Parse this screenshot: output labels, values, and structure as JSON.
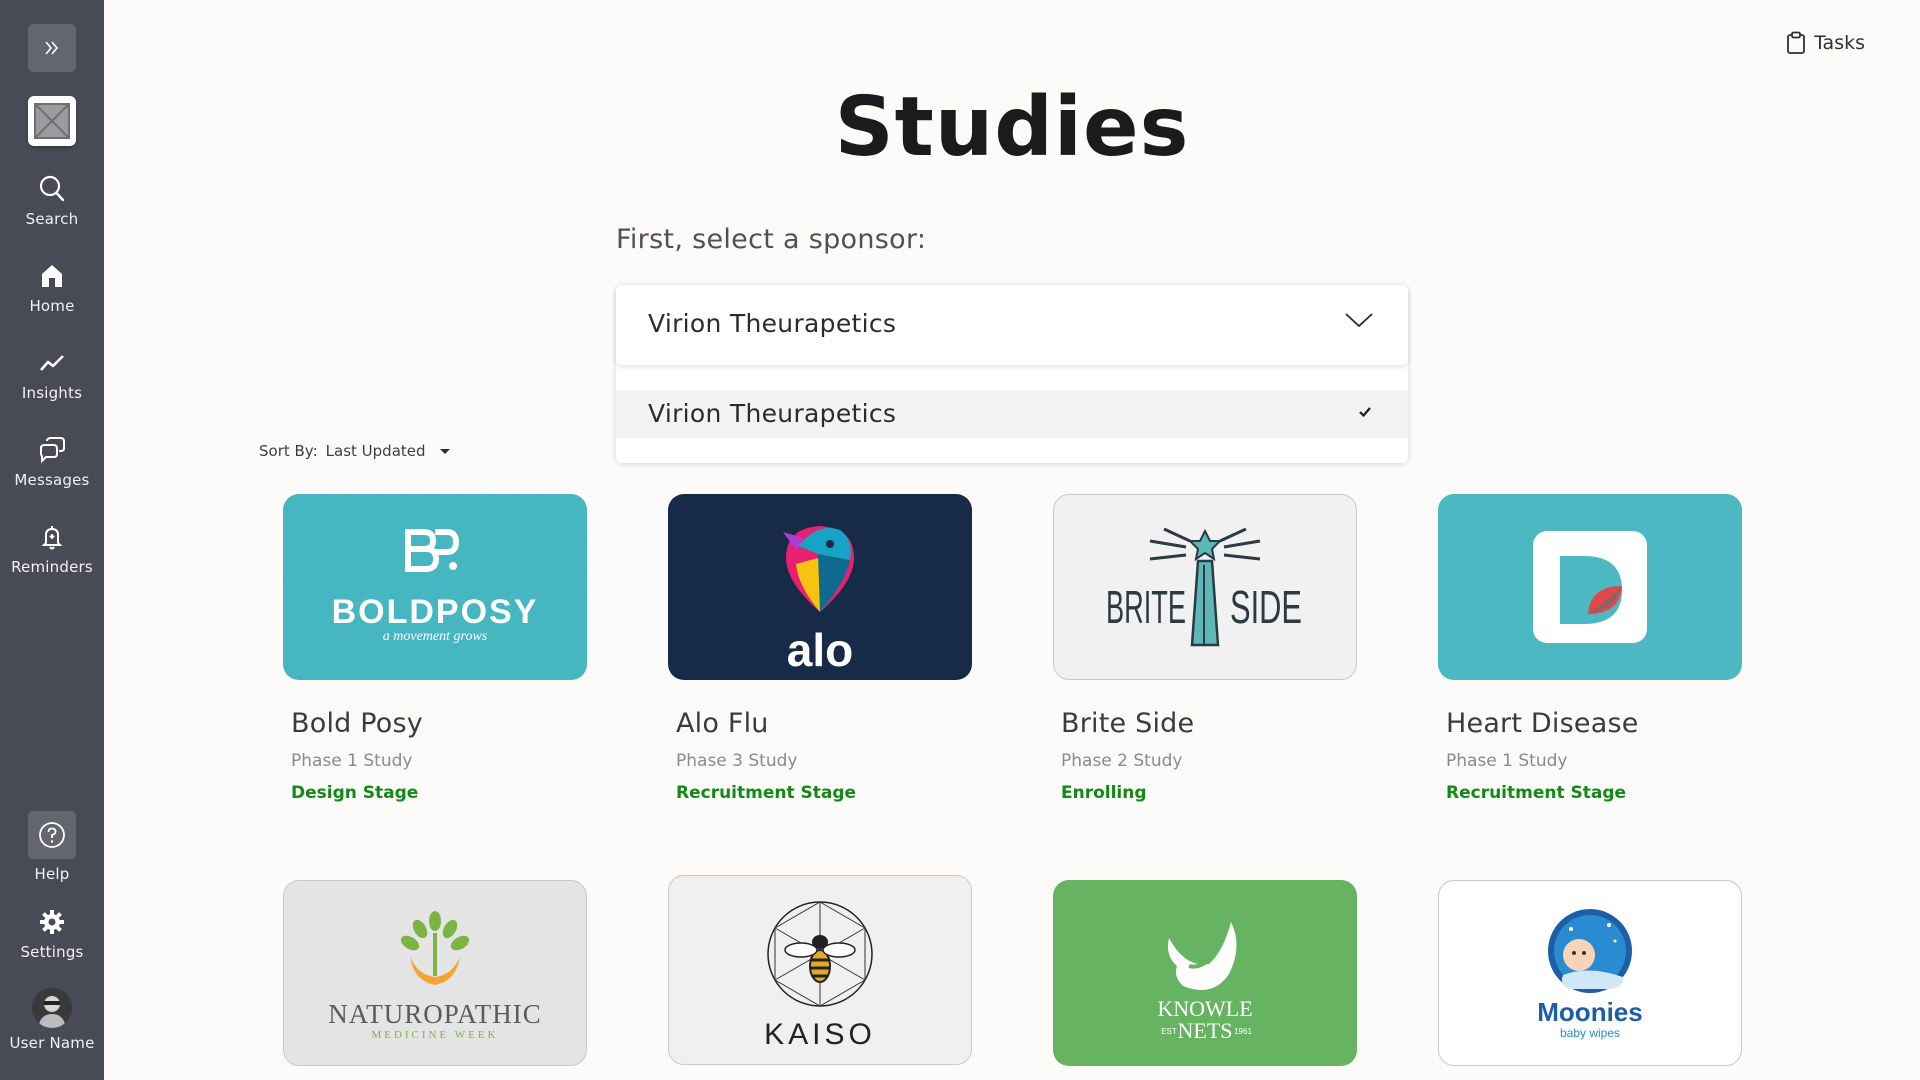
{
  "sidebar": {
    "expand_icon": "double-chevron-right-icon",
    "nav": [
      {
        "label": "Search",
        "icon": "search-icon"
      },
      {
        "label": "Home",
        "icon": "home-icon"
      },
      {
        "label": "Insights",
        "icon": "trend-line-icon"
      },
      {
        "label": "Messages",
        "icon": "chat-bubbles-icon"
      },
      {
        "label": "Reminders",
        "icon": "bell-icon"
      }
    ],
    "help_label": "Help",
    "settings_label": "Settings",
    "user_label": "User Name"
  },
  "header": {
    "tasks_label": "Tasks"
  },
  "page": {
    "title": "Studies",
    "prompt": "First, select a sponsor:"
  },
  "sponsor_select": {
    "value": "Virion Theurapetics",
    "options": [
      {
        "label": "Virion Theurapetics",
        "selected": true
      }
    ]
  },
  "sort": {
    "label": "Sort By:",
    "value": "Last Updated"
  },
  "studies": [
    {
      "title": "Bold Posy",
      "phase": "Phase 1 Study",
      "stage": "Design Stage",
      "logo_text": "BOLDPOSY",
      "logo_sub": "a movement grows"
    },
    {
      "title": "Alo Flu",
      "phase": "Phase 3 Study",
      "stage": "Recruitment Stage",
      "logo_text": "alo"
    },
    {
      "title": "Brite Side",
      "phase": "Phase 2 Study",
      "stage": "Enrolling",
      "logo_text_left": "BRITE",
      "logo_text_right": "SIDE"
    },
    {
      "title": "Heart Disease",
      "phase": "Phase 1 Study",
      "stage": "Recruitment Stage"
    },
    {
      "logo_text": "NATUROPATHIC",
      "logo_sub": "MEDICINE WEEK"
    },
    {
      "logo_text": "KAISO"
    },
    {
      "logo_text": "KNOWLE",
      "logo_sub": "NETS",
      "logo_left": "EST",
      "logo_right": "1961"
    },
    {
      "logo_text": "Moonies",
      "logo_sub": "baby wipes"
    }
  ],
  "colors": {
    "sidebar": "#484a55",
    "stage_green": "#138a16",
    "boldposy_teal": "#45b5c0",
    "alo_navy": "#172a47",
    "heart_teal": "#4cb8c2",
    "knowle_green": "#66b462"
  }
}
